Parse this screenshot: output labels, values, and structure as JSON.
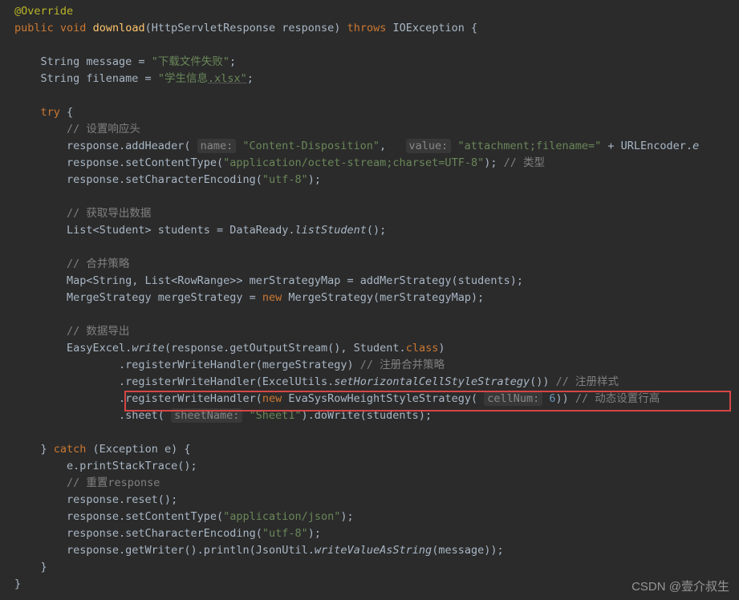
{
  "annotation": "@Override",
  "sig": {
    "public": "public",
    "void": "void",
    "name": "download",
    "open": "(HttpServletResponse response) ",
    "throws": "throws",
    "exc": " IOException {"
  },
  "l1a": "    String message = ",
  "l1s": "\"下载文件失败\"",
  "l1b": ";",
  "l2a": "    String filename = ",
  "l2s1": "\"学生信息",
  "l2s2": ".xlsx\"",
  "l2b": ";",
  "try": "try",
  "tryOpen": " {",
  "c1": "// 设置响应头",
  "l3a": "        response.addHeader( ",
  "l3h1": "name:",
  "l3s1": " \"Content-Disposition\"",
  "l3m": ",   ",
  "l3h2": "value:",
  "l3s2": " \"attachment;filename=\"",
  "l3b": " + URLEncoder.",
  "l3e": "e",
  "l4a": "        response.setContentType(",
  "l4s": "\"application/octet-stream;charset=UTF-8\"",
  "l4b": "); ",
  "l4c": "// 类型",
  "l5a": "        response.setCharacterEncoding(",
  "l5s": "\"utf-8\"",
  "l5b": ");",
  "c2": "// 获取导出数据",
  "l6a": "        List<Student> students = DataReady.",
  "l6i": "listStudent",
  "l6b": "();",
  "c3": "// 合并策略",
  "l7": "        Map<String, List<RowRange>> merStrategyMap = addMerStrategy(students);",
  "l8a": "        MergeStrategy mergeStrategy = ",
  "l8n": "new",
  "l8b": " MergeStrategy(merStrategyMap);",
  "c4": "// 数据导出",
  "l9a": "        EasyExcel.",
  "l9i": "write",
  "l9b": "(response.getOutputStream(), Student.",
  "l9c": "class",
  "l9d": ")",
  "l10a": "                .registerWriteHandler(mergeStrategy) ",
  "l10c": "// 注册合并策略",
  "l11a": "                .registerWriteHandler(ExcelUtils.",
  "l11i": "setHorizontalCellStyleStrategy",
  "l11b": "()) ",
  "l11c": "// 注册样式",
  "l12a": "                .registerWriteHandler(",
  "l12n": "new",
  "l12b": " EvaSysRowHeightStyleStrategy( ",
  "l12h": "cellNum:",
  "l12num": " 6",
  "l12c": ")) ",
  "l12cm": "// 动态设置行高",
  "l13a": "                .sheet( ",
  "l13h": "sheetName:",
  "l13s": " \"Sheet1\"",
  "l13b": ").doWrite(students);",
  "catchA": "    } ",
  "catch": "catch",
  "catchB": " (Exception e) {",
  "l14": "        e.printStackTrace();",
  "c5": "// 重置response",
  "l15": "        response.reset();",
  "l16a": "        response.setContentType(",
  "l16s": "\"application/json\"",
  "l16b": ");",
  "l17a": "        response.setCharacterEncoding(",
  "l17s": "\"utf-8\"",
  "l17b": ");",
  "l18a": "        response.getWriter().println(JsonUtil.",
  "l18i": "writeValueAsString",
  "l18b": "(message));",
  "closeInner": "    }",
  "closeOuter": "}",
  "watermark": "CSDN @壹介叔生"
}
